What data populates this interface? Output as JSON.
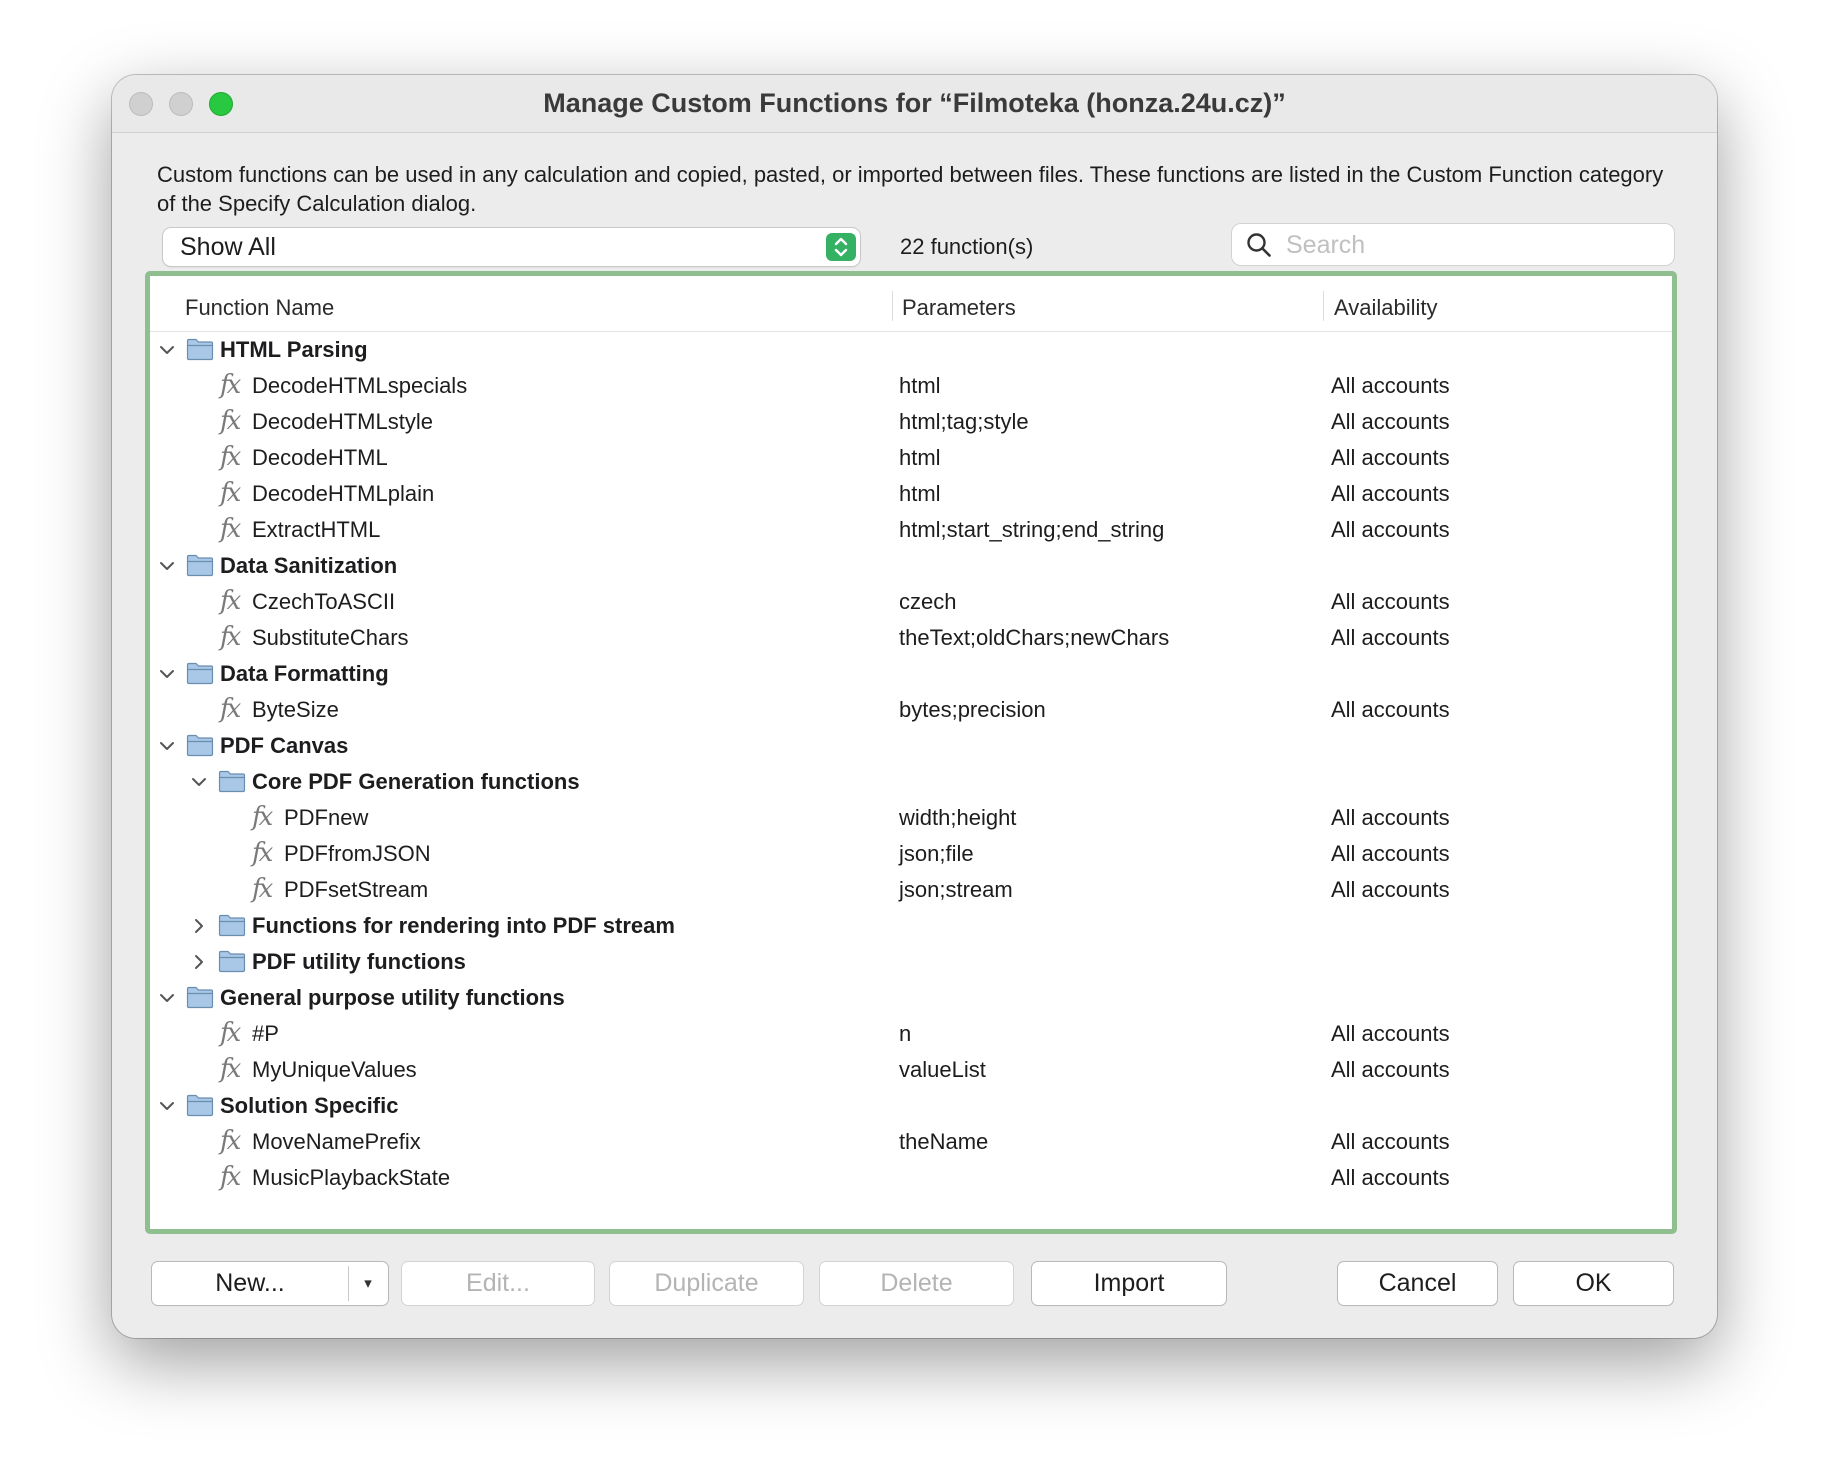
{
  "window": {
    "title": "Manage Custom Functions for “Filmoteka (honza.24u.cz)”",
    "description": "Custom functions can be used in any calculation and copied, pasted, or imported between files. These functions are listed in the Custom Function category of the Specify Calculation dialog."
  },
  "toolbar": {
    "filter_value": "Show All",
    "count_label": "22 function(s)",
    "search_placeholder": "Search"
  },
  "table": {
    "columns": [
      "Function Name",
      "Parameters",
      "Availability"
    ],
    "rows": [
      {
        "type": "group",
        "level": 0,
        "expanded": true,
        "name": "HTML Parsing"
      },
      {
        "type": "function",
        "level": 1,
        "name": "DecodeHTMLspecials",
        "params": "html",
        "availability": "All accounts"
      },
      {
        "type": "function",
        "level": 1,
        "name": "DecodeHTMLstyle",
        "params": "html;tag;style",
        "availability": "All accounts"
      },
      {
        "type": "function",
        "level": 1,
        "name": "DecodeHTML",
        "params": "html",
        "availability": "All accounts"
      },
      {
        "type": "function",
        "level": 1,
        "name": "DecodeHTMLplain",
        "params": "html",
        "availability": "All accounts"
      },
      {
        "type": "function",
        "level": 1,
        "name": "ExtractHTML",
        "params": "html;start_string;end_string",
        "availability": "All accounts"
      },
      {
        "type": "group",
        "level": 0,
        "expanded": true,
        "name": "Data Sanitization"
      },
      {
        "type": "function",
        "level": 1,
        "name": "CzechToASCII",
        "params": "czech",
        "availability": "All accounts"
      },
      {
        "type": "function",
        "level": 1,
        "name": "SubstituteChars",
        "params": "theText;oldChars;newChars",
        "availability": "All accounts"
      },
      {
        "type": "group",
        "level": 0,
        "expanded": true,
        "name": "Data Formatting"
      },
      {
        "type": "function",
        "level": 1,
        "name": "ByteSize",
        "params": "bytes;precision",
        "availability": "All accounts"
      },
      {
        "type": "group",
        "level": 0,
        "expanded": true,
        "name": "PDF Canvas"
      },
      {
        "type": "group",
        "level": 1,
        "expanded": true,
        "name": "Core PDF Generation functions"
      },
      {
        "type": "function",
        "level": 2,
        "name": "PDFnew",
        "params": "width;height",
        "availability": "All accounts"
      },
      {
        "type": "function",
        "level": 2,
        "name": "PDFfromJSON",
        "params": "json;file",
        "availability": "All accounts"
      },
      {
        "type": "function",
        "level": 2,
        "name": "PDFsetStream",
        "params": "json;stream",
        "availability": "All accounts"
      },
      {
        "type": "group",
        "level": 1,
        "expanded": false,
        "name": "Functions for rendering into PDF stream"
      },
      {
        "type": "group",
        "level": 1,
        "expanded": false,
        "name": "PDF utility functions"
      },
      {
        "type": "group",
        "level": 0,
        "expanded": true,
        "name": "General purpose utility functions"
      },
      {
        "type": "function",
        "level": 1,
        "name": "#P",
        "params": "n",
        "availability": "All accounts"
      },
      {
        "type": "function",
        "level": 1,
        "name": "MyUniqueValues",
        "params": "valueList",
        "availability": "All accounts"
      },
      {
        "type": "group",
        "level": 0,
        "expanded": true,
        "name": "Solution Specific"
      },
      {
        "type": "function",
        "level": 1,
        "name": "MoveNamePrefix",
        "params": "theName",
        "availability": "All accounts"
      },
      {
        "type": "function",
        "level": 1,
        "name": "MusicPlaybackState",
        "params": "",
        "availability": "All accounts"
      }
    ]
  },
  "icons": {
    "folder": "folder-icon",
    "function": "fx-icon",
    "expanded": "chevron-down-icon",
    "collapsed": "chevron-right-icon"
  },
  "fx_glyph": "fx",
  "buttons": {
    "new": "New...",
    "new_menu": "▾",
    "edit": "Edit...",
    "duplicate": "Duplicate",
    "delete": "Delete",
    "import": "Import",
    "cancel": "Cancel",
    "ok": "OK"
  },
  "colors": {
    "accent_green": "#34b163",
    "focus_ring": "#8fbe8f",
    "zoom_button": "#28c840",
    "folder_fill": "#a9c7e6",
    "folder_stroke": "#6a8db0"
  }
}
